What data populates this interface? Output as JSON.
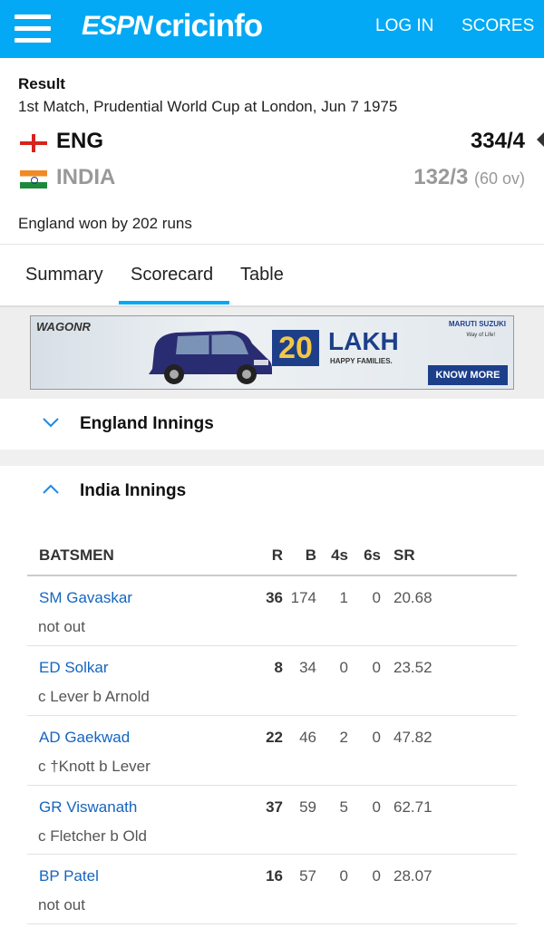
{
  "header": {
    "logo_espn": "ESPN",
    "logo_cricinfo": "cricinfo",
    "login_label": "LOG IN",
    "scores_label": "SCORES",
    "background_color": "#03a9f4"
  },
  "match": {
    "status": "Result",
    "description": "1st Match, Prudential World Cup at London, Jun 7 1975",
    "team1": {
      "name": "ENG",
      "score": "334/4",
      "flag": "england-flag"
    },
    "team2": {
      "name": "INDIA",
      "score": "132/3",
      "overs": "(60 ov)",
      "flag": "india-flag"
    },
    "result": "England won by 202 runs"
  },
  "tabs": {
    "summary": "Summary",
    "scorecard": "Scorecard",
    "table": "Table",
    "active": "Scorecard"
  },
  "ad": {
    "brand": "WAGONR",
    "badge": "20",
    "headline": "LAKH",
    "subline": "HAPPY FAMILIES.",
    "maker": "MARUTI SUZUKI",
    "tagline": "Way of Life!",
    "cta": "KNOW MORE"
  },
  "innings": {
    "england": {
      "label": "England Innings",
      "expanded": false
    },
    "india": {
      "label": "India Innings",
      "expanded": true
    }
  },
  "batting": {
    "headers": {
      "batsmen": "BATSMEN",
      "r": "R",
      "b": "B",
      "fours": "4s",
      "sixes": "6s",
      "sr": "SR"
    },
    "rows": [
      {
        "name": "SM Gavaskar",
        "dismissal": "not out",
        "r": "36",
        "b": "174",
        "fours": "1",
        "sixes": "0",
        "sr": "20.68"
      },
      {
        "name": "ED Solkar",
        "dismissal": "c Lever b Arnold",
        "r": "8",
        "b": "34",
        "fours": "0",
        "sixes": "0",
        "sr": "23.52"
      },
      {
        "name": "AD Gaekwad",
        "dismissal": "c †Knott b Lever",
        "r": "22",
        "b": "46",
        "fours": "2",
        "sixes": "0",
        "sr": "47.82"
      },
      {
        "name": "GR Viswanath",
        "dismissal": "c Fletcher b Old",
        "r": "37",
        "b": "59",
        "fours": "5",
        "sixes": "0",
        "sr": "62.71"
      },
      {
        "name": "BP Patel",
        "dismissal": "not out",
        "r": "16",
        "b": "57",
        "fours": "0",
        "sixes": "0",
        "sr": "28.07"
      }
    ]
  }
}
